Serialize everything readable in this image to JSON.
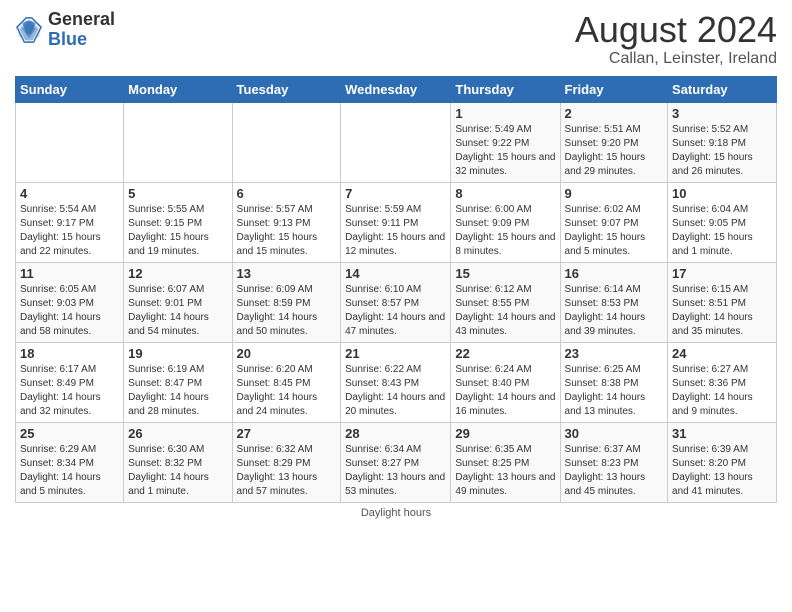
{
  "header": {
    "logo_general": "General",
    "logo_blue": "Blue",
    "month_title": "August 2024",
    "location": "Callan, Leinster, Ireland"
  },
  "days_of_week": [
    "Sunday",
    "Monday",
    "Tuesday",
    "Wednesday",
    "Thursday",
    "Friday",
    "Saturday"
  ],
  "footer": {
    "daylight_label": "Daylight hours"
  },
  "weeks": [
    [
      {
        "day": "",
        "sunrise": "",
        "sunset": "",
        "daylight": ""
      },
      {
        "day": "",
        "sunrise": "",
        "sunset": "",
        "daylight": ""
      },
      {
        "day": "",
        "sunrise": "",
        "sunset": "",
        "daylight": ""
      },
      {
        "day": "",
        "sunrise": "",
        "sunset": "",
        "daylight": ""
      },
      {
        "day": "1",
        "sunrise": "Sunrise: 5:49 AM",
        "sunset": "Sunset: 9:22 PM",
        "daylight": "Daylight: 15 hours and 32 minutes."
      },
      {
        "day": "2",
        "sunrise": "Sunrise: 5:51 AM",
        "sunset": "Sunset: 9:20 PM",
        "daylight": "Daylight: 15 hours and 29 minutes."
      },
      {
        "day": "3",
        "sunrise": "Sunrise: 5:52 AM",
        "sunset": "Sunset: 9:18 PM",
        "daylight": "Daylight: 15 hours and 26 minutes."
      }
    ],
    [
      {
        "day": "4",
        "sunrise": "Sunrise: 5:54 AM",
        "sunset": "Sunset: 9:17 PM",
        "daylight": "Daylight: 15 hours and 22 minutes."
      },
      {
        "day": "5",
        "sunrise": "Sunrise: 5:55 AM",
        "sunset": "Sunset: 9:15 PM",
        "daylight": "Daylight: 15 hours and 19 minutes."
      },
      {
        "day": "6",
        "sunrise": "Sunrise: 5:57 AM",
        "sunset": "Sunset: 9:13 PM",
        "daylight": "Daylight: 15 hours and 15 minutes."
      },
      {
        "day": "7",
        "sunrise": "Sunrise: 5:59 AM",
        "sunset": "Sunset: 9:11 PM",
        "daylight": "Daylight: 15 hours and 12 minutes."
      },
      {
        "day": "8",
        "sunrise": "Sunrise: 6:00 AM",
        "sunset": "Sunset: 9:09 PM",
        "daylight": "Daylight: 15 hours and 8 minutes."
      },
      {
        "day": "9",
        "sunrise": "Sunrise: 6:02 AM",
        "sunset": "Sunset: 9:07 PM",
        "daylight": "Daylight: 15 hours and 5 minutes."
      },
      {
        "day": "10",
        "sunrise": "Sunrise: 6:04 AM",
        "sunset": "Sunset: 9:05 PM",
        "daylight": "Daylight: 15 hours and 1 minute."
      }
    ],
    [
      {
        "day": "11",
        "sunrise": "Sunrise: 6:05 AM",
        "sunset": "Sunset: 9:03 PM",
        "daylight": "Daylight: 14 hours and 58 minutes."
      },
      {
        "day": "12",
        "sunrise": "Sunrise: 6:07 AM",
        "sunset": "Sunset: 9:01 PM",
        "daylight": "Daylight: 14 hours and 54 minutes."
      },
      {
        "day": "13",
        "sunrise": "Sunrise: 6:09 AM",
        "sunset": "Sunset: 8:59 PM",
        "daylight": "Daylight: 14 hours and 50 minutes."
      },
      {
        "day": "14",
        "sunrise": "Sunrise: 6:10 AM",
        "sunset": "Sunset: 8:57 PM",
        "daylight": "Daylight: 14 hours and 47 minutes."
      },
      {
        "day": "15",
        "sunrise": "Sunrise: 6:12 AM",
        "sunset": "Sunset: 8:55 PM",
        "daylight": "Daylight: 14 hours and 43 minutes."
      },
      {
        "day": "16",
        "sunrise": "Sunrise: 6:14 AM",
        "sunset": "Sunset: 8:53 PM",
        "daylight": "Daylight: 14 hours and 39 minutes."
      },
      {
        "day": "17",
        "sunrise": "Sunrise: 6:15 AM",
        "sunset": "Sunset: 8:51 PM",
        "daylight": "Daylight: 14 hours and 35 minutes."
      }
    ],
    [
      {
        "day": "18",
        "sunrise": "Sunrise: 6:17 AM",
        "sunset": "Sunset: 8:49 PM",
        "daylight": "Daylight: 14 hours and 32 minutes."
      },
      {
        "day": "19",
        "sunrise": "Sunrise: 6:19 AM",
        "sunset": "Sunset: 8:47 PM",
        "daylight": "Daylight: 14 hours and 28 minutes."
      },
      {
        "day": "20",
        "sunrise": "Sunrise: 6:20 AM",
        "sunset": "Sunset: 8:45 PM",
        "daylight": "Daylight: 14 hours and 24 minutes."
      },
      {
        "day": "21",
        "sunrise": "Sunrise: 6:22 AM",
        "sunset": "Sunset: 8:43 PM",
        "daylight": "Daylight: 14 hours and 20 minutes."
      },
      {
        "day": "22",
        "sunrise": "Sunrise: 6:24 AM",
        "sunset": "Sunset: 8:40 PM",
        "daylight": "Daylight: 14 hours and 16 minutes."
      },
      {
        "day": "23",
        "sunrise": "Sunrise: 6:25 AM",
        "sunset": "Sunset: 8:38 PM",
        "daylight": "Daylight: 14 hours and 13 minutes."
      },
      {
        "day": "24",
        "sunrise": "Sunrise: 6:27 AM",
        "sunset": "Sunset: 8:36 PM",
        "daylight": "Daylight: 14 hours and 9 minutes."
      }
    ],
    [
      {
        "day": "25",
        "sunrise": "Sunrise: 6:29 AM",
        "sunset": "Sunset: 8:34 PM",
        "daylight": "Daylight: 14 hours and 5 minutes."
      },
      {
        "day": "26",
        "sunrise": "Sunrise: 6:30 AM",
        "sunset": "Sunset: 8:32 PM",
        "daylight": "Daylight: 14 hours and 1 minute."
      },
      {
        "day": "27",
        "sunrise": "Sunrise: 6:32 AM",
        "sunset": "Sunset: 8:29 PM",
        "daylight": "Daylight: 13 hours and 57 minutes."
      },
      {
        "day": "28",
        "sunrise": "Sunrise: 6:34 AM",
        "sunset": "Sunset: 8:27 PM",
        "daylight": "Daylight: 13 hours and 53 minutes."
      },
      {
        "day": "29",
        "sunrise": "Sunrise: 6:35 AM",
        "sunset": "Sunset: 8:25 PM",
        "daylight": "Daylight: 13 hours and 49 minutes."
      },
      {
        "day": "30",
        "sunrise": "Sunrise: 6:37 AM",
        "sunset": "Sunset: 8:23 PM",
        "daylight": "Daylight: 13 hours and 45 minutes."
      },
      {
        "day": "31",
        "sunrise": "Sunrise: 6:39 AM",
        "sunset": "Sunset: 8:20 PM",
        "daylight": "Daylight: 13 hours and 41 minutes."
      }
    ]
  ]
}
